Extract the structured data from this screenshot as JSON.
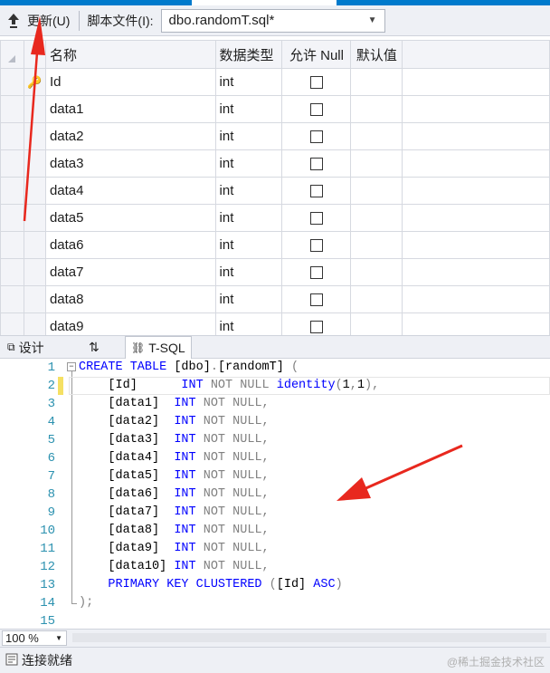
{
  "colors": {
    "accent": "#007acc",
    "keyword": "#0000ff",
    "comment_gray": "#808080",
    "function": "#ff00ff",
    "line_number": "#2b91af",
    "annotation_arrow": "#e8281e"
  },
  "toolbar": {
    "update_label": "更新(U)",
    "script_label": "脚本文件(I):",
    "script_file": "dbo.randomT.sql*"
  },
  "grid": {
    "headers": [
      "名称",
      "数据类型",
      "允许 Null",
      "默认值"
    ],
    "rows": [
      {
        "name": "Id",
        "type": "int",
        "key": true
      },
      {
        "name": "data1",
        "type": "int"
      },
      {
        "name": "data2",
        "type": "int"
      },
      {
        "name": "data3",
        "type": "int"
      },
      {
        "name": "data4",
        "type": "int"
      },
      {
        "name": "data5",
        "type": "int"
      },
      {
        "name": "data6",
        "type": "int"
      },
      {
        "name": "data7",
        "type": "int"
      },
      {
        "name": "data8",
        "type": "int"
      },
      {
        "name": "data9",
        "type": "int"
      }
    ]
  },
  "pane_tabs": {
    "design": "设计",
    "swap": "⇅",
    "tsql": "T-SQL"
  },
  "editor": {
    "lines": [
      {
        "n": "1",
        "parts": [
          [
            "kw",
            "CREATE TABLE "
          ],
          [
            "t",
            "[dbo]"
          ],
          [
            "gray",
            "."
          ],
          [
            "t",
            "[randomT] "
          ],
          [
            "gray",
            "("
          ]
        ]
      },
      {
        "n": "2",
        "parts": [
          [
            "t",
            "    [Id]      "
          ],
          [
            "kw",
            "INT "
          ],
          [
            "gray",
            "NOT NULL "
          ],
          [
            "kw",
            "identity"
          ],
          [
            "gray",
            "("
          ],
          [
            "t",
            "1"
          ],
          [
            "gray",
            ","
          ],
          [
            "t",
            "1"
          ],
          [
            "gray",
            "),"
          ]
        ]
      },
      {
        "n": "3",
        "parts": [
          [
            "t",
            "    [data1]  "
          ],
          [
            "kw",
            "INT "
          ],
          [
            "gray",
            "NOT NULL,"
          ]
        ]
      },
      {
        "n": "4",
        "parts": [
          [
            "t",
            "    [data2]  "
          ],
          [
            "kw",
            "INT "
          ],
          [
            "gray",
            "NOT NULL,"
          ]
        ]
      },
      {
        "n": "5",
        "parts": [
          [
            "t",
            "    [data3]  "
          ],
          [
            "kw",
            "INT "
          ],
          [
            "gray",
            "NOT NULL,"
          ]
        ]
      },
      {
        "n": "6",
        "parts": [
          [
            "t",
            "    [data4]  "
          ],
          [
            "kw",
            "INT "
          ],
          [
            "gray",
            "NOT NULL,"
          ]
        ]
      },
      {
        "n": "7",
        "parts": [
          [
            "t",
            "    [data5]  "
          ],
          [
            "kw",
            "INT "
          ],
          [
            "gray",
            "NOT NULL,"
          ]
        ]
      },
      {
        "n": "8",
        "parts": [
          [
            "t",
            "    [data6]  "
          ],
          [
            "kw",
            "INT "
          ],
          [
            "gray",
            "NOT NULL,"
          ]
        ]
      },
      {
        "n": "9",
        "parts": [
          [
            "t",
            "    [data7]  "
          ],
          [
            "kw",
            "INT "
          ],
          [
            "gray",
            "NOT NULL,"
          ]
        ]
      },
      {
        "n": "10",
        "parts": [
          [
            "t",
            "    [data8]  "
          ],
          [
            "kw",
            "INT "
          ],
          [
            "gray",
            "NOT NULL,"
          ]
        ]
      },
      {
        "n": "11",
        "parts": [
          [
            "t",
            "    [data9]  "
          ],
          [
            "kw",
            "INT "
          ],
          [
            "gray",
            "NOT NULL,"
          ]
        ]
      },
      {
        "n": "12",
        "parts": [
          [
            "t",
            "    [data10] "
          ],
          [
            "kw",
            "INT "
          ],
          [
            "gray",
            "NOT NULL,"
          ]
        ]
      },
      {
        "n": "13",
        "parts": [
          [
            "t",
            "    "
          ],
          [
            "kw",
            "PRIMARY KEY CLUSTERED "
          ],
          [
            "gray",
            "("
          ],
          [
            "t",
            "[Id] "
          ],
          [
            "kw",
            "ASC"
          ],
          [
            "gray",
            ")"
          ]
        ]
      },
      {
        "n": "14",
        "parts": [
          [
            "gray",
            ");"
          ]
        ]
      },
      {
        "n": "15",
        "parts": []
      }
    ]
  },
  "zoom": {
    "level": "100 %"
  },
  "status": {
    "text": "连接就绪",
    "watermark": "@稀土掘金技术社区"
  }
}
